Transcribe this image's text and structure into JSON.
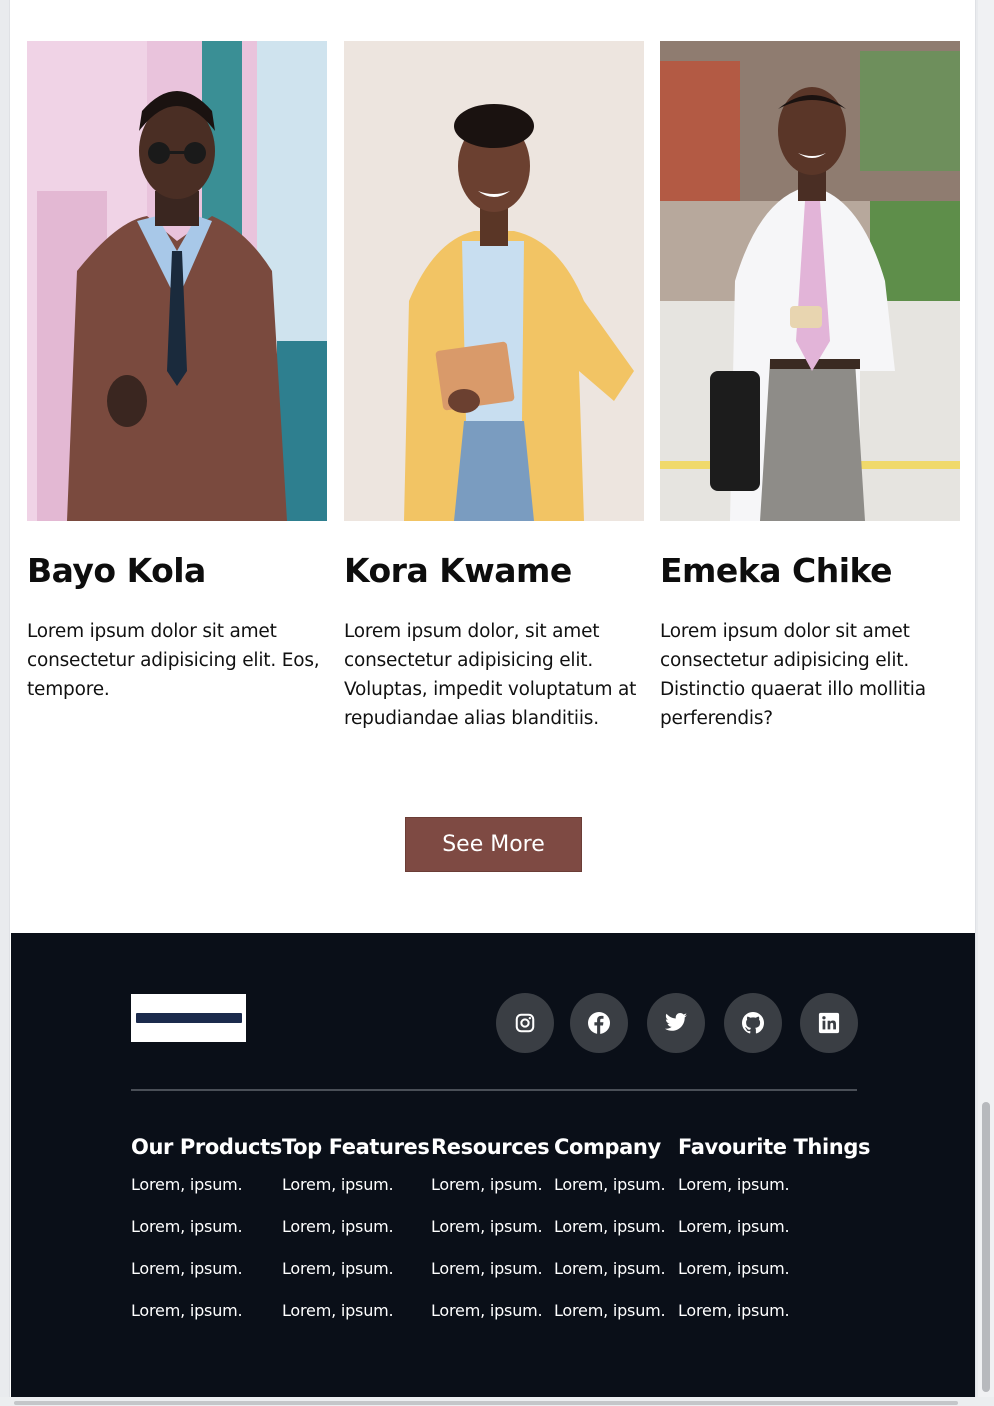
{
  "team": [
    {
      "name": "Bayo Kola",
      "bio": "Lorem ipsum dolor sit amet consectetur adipisicing elit. Eos, tempore.",
      "photo_alt": "man in brown leather jacket and sunglasses"
    },
    {
      "name": "Kora Kwame",
      "bio": "Lorem ipsum dolor, sit amet consectetur adipisicing elit. Voluptas, impedit voluptatum at repudiandae alias blanditiis.",
      "photo_alt": "woman in yellow blazer holding a tablet"
    },
    {
      "name": "Emeka Chike",
      "bio": "Lorem ipsum dolor sit amet consectetur adipisicing elit. Distinctio quaerat illo mollitia perferendis?",
      "photo_alt": "man in white shirt and pink tie holding a phone"
    }
  ],
  "see_more_label": "See More",
  "footer": {
    "logo_text": "logo",
    "social_icons": [
      "instagram-icon",
      "facebook-icon",
      "twitter-icon",
      "github-icon",
      "linkedin-icon"
    ],
    "columns": [
      {
        "title": "Our Products",
        "links": [
          "Lorem, ipsum.",
          "Lorem, ipsum.",
          "Lorem, ipsum.",
          "Lorem, ipsum."
        ]
      },
      {
        "title": "Top Features",
        "links": [
          "Lorem, ipsum.",
          "Lorem, ipsum.",
          "Lorem, ipsum.",
          "Lorem, ipsum."
        ]
      },
      {
        "title": "Resources",
        "links": [
          "Lorem, ipsum.",
          "Lorem, ipsum.",
          "Lorem, ipsum.",
          "Lorem, ipsum."
        ]
      },
      {
        "title": "Company",
        "links": [
          "Lorem, ipsum.",
          "Lorem, ipsum.",
          "Lorem, ipsum.",
          "Lorem, ipsum."
        ]
      },
      {
        "title": "Favourite Things",
        "links": [
          "Lorem, ipsum.",
          "Lorem, ipsum.",
          "Lorem, ipsum.",
          "Lorem, ipsum."
        ]
      }
    ]
  },
  "colors": {
    "button_bg": "#7e4a43",
    "footer_bg": "#0a0f18",
    "social_bg": "#3a3e44"
  }
}
